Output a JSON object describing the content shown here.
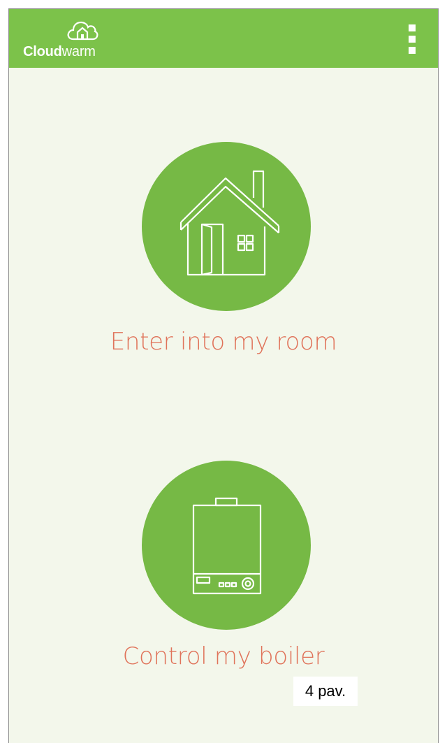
{
  "app": {
    "logo_bold": "Cloud",
    "logo_light": "warm",
    "logo_icon": "cloud-house-icon",
    "menu_icon": "overflow-menu-icon"
  },
  "colors": {
    "appbar": "#7cc24a",
    "background": "#f3f7eb",
    "circle": "#76b945",
    "label": "#e0735a"
  },
  "main": {
    "options": [
      {
        "label": "Enter into my room",
        "icon": "house-icon"
      },
      {
        "label": "Control my boiler",
        "icon": "boiler-icon"
      }
    ]
  },
  "page_label": "4 pav."
}
